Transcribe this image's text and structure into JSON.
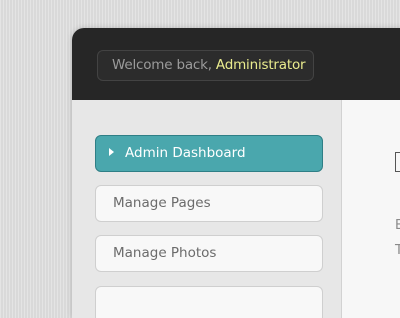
{
  "header": {
    "welcome_prefix": "Welcome back, ",
    "username": "Administrator"
  },
  "sidebar": {
    "items": [
      {
        "label": "Admin Dashboard",
        "active": true
      },
      {
        "label": "Manage Pages",
        "active": false
      },
      {
        "label": "Manage Photos",
        "active": false
      },
      {
        "label": "",
        "active": false
      }
    ]
  },
  "main": {
    "line1": "E",
    "line2": "T"
  },
  "colors": {
    "accent": "#4aa7ad",
    "header_bg": "#262626",
    "username": "#eaec8e"
  },
  "icons": {
    "active_marker": "caret-right-icon"
  }
}
